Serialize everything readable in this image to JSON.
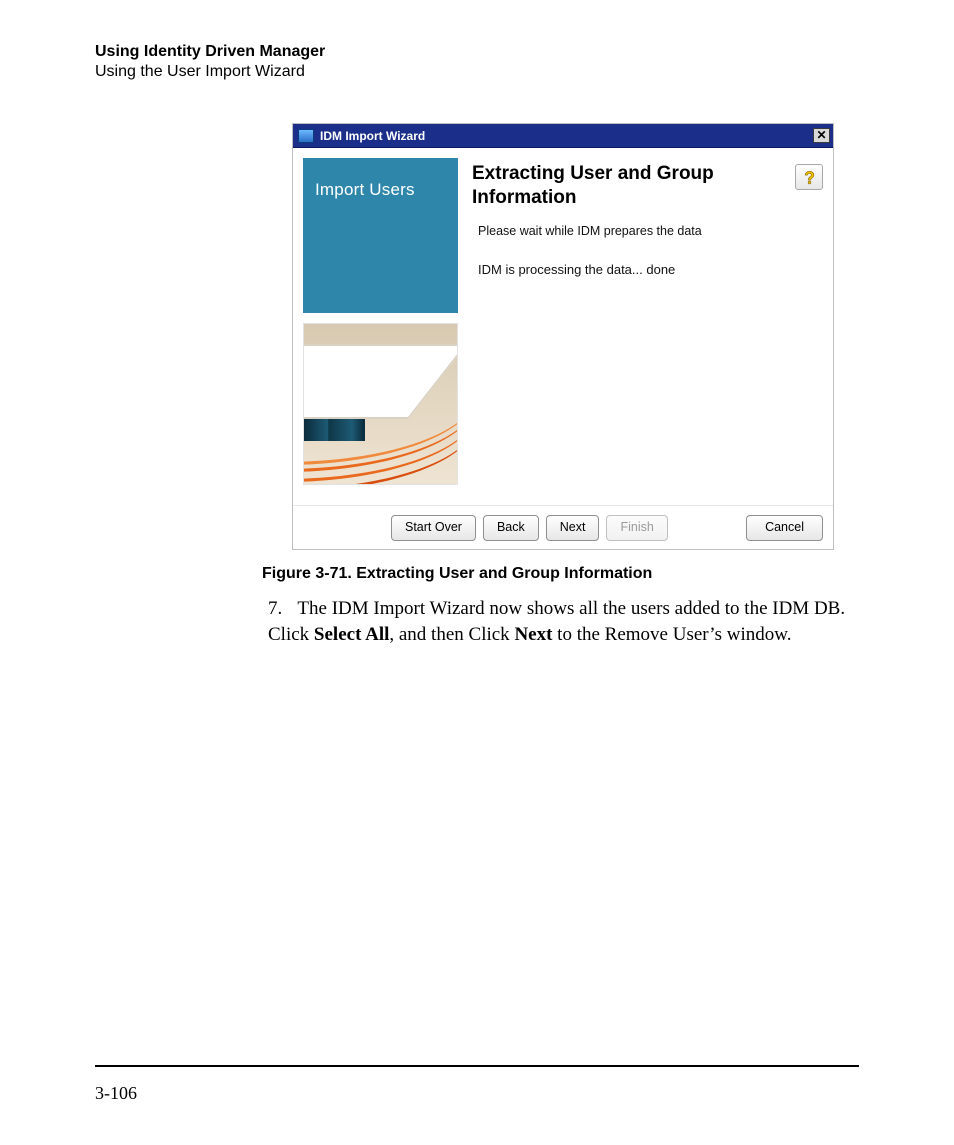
{
  "header": {
    "title_bold": "Using Identity Driven Manager",
    "subtitle": "Using the User Import Wizard"
  },
  "wizard": {
    "window_title": "IDM Import Wizard",
    "side_label": "Import Users",
    "content_title": "Extracting User and Group Information",
    "content_sub": "Please wait while IDM prepares the data",
    "content_status": "IDM is processing the data... done",
    "buttons": {
      "start_over": "Start Over",
      "back": "Back",
      "next": "Next",
      "finish": "Finish",
      "cancel": "Cancel"
    }
  },
  "caption": "Figure 3-71. Extracting User and Group Information",
  "step": {
    "number": "7.",
    "pre": "The IDM Import Wizard now shows all the users added to the IDM DB. Click ",
    "b1": "Select All",
    "mid": ", and then Click ",
    "b2": "Next",
    "post": " to the Remove User’s window."
  },
  "page_number": "3-106"
}
